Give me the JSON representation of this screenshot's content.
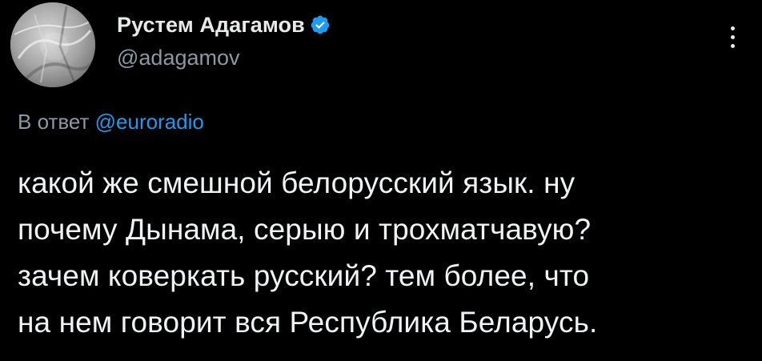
{
  "author": {
    "display_name": "Рустем Адагамов",
    "handle": "@adagamov",
    "verified": true
  },
  "reply_context": {
    "prefix": "В ответ",
    "mention": "@euroradio"
  },
  "tweet": {
    "lines": [
      "какой же смешной белорусский язык. ну",
      "почему Дынама, серыю и трохматчавую?",
      "зачем коверкать русский? тем более, что",
      "на нем говорит вся Республика Беларусь."
    ]
  },
  "colors": {
    "background": "#000000",
    "text": "#e7e9ea",
    "secondary": "#8b98a5",
    "link": "#1d9bf0",
    "verified": "#1d9bf0"
  },
  "icons": {
    "verified": "verified-badge-icon",
    "more": "more-vertical-icon"
  }
}
